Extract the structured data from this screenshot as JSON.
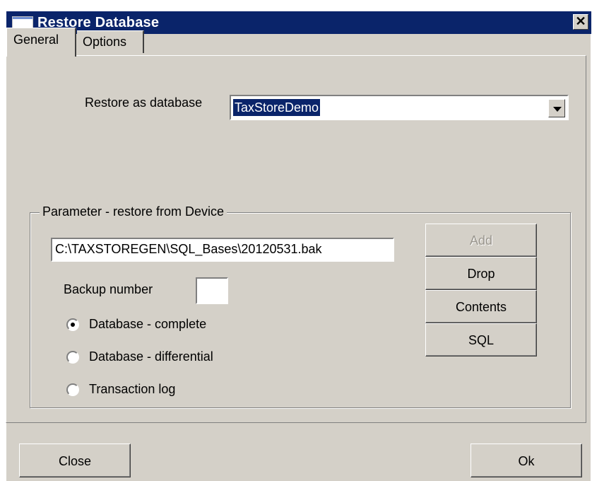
{
  "window": {
    "title": "Restore Database",
    "close_glyph": "✕"
  },
  "tabs": [
    {
      "label": "General",
      "active": true
    },
    {
      "label": "Options",
      "active": false
    }
  ],
  "restore": {
    "label": "Restore as database",
    "value": "TaxStoreDemo"
  },
  "group": {
    "legend": "Parameter - restore from Device",
    "path": "C:\\TAXSTOREGEN\\SQL_Bases\\20120531.bak",
    "backup_number_label": "Backup number",
    "backup_number_value": "",
    "radios": [
      {
        "label": "Database - complete",
        "checked": true
      },
      {
        "label": "Database - differential",
        "checked": false
      },
      {
        "label": "Transaction log",
        "checked": false
      }
    ],
    "buttons": [
      {
        "label": "Add",
        "enabled": false
      },
      {
        "label": "Drop",
        "enabled": true
      },
      {
        "label": "Contents",
        "enabled": true
      },
      {
        "label": "SQL",
        "enabled": true
      }
    ]
  },
  "footer": {
    "close_label": "Close",
    "ok_label": "Ok"
  }
}
